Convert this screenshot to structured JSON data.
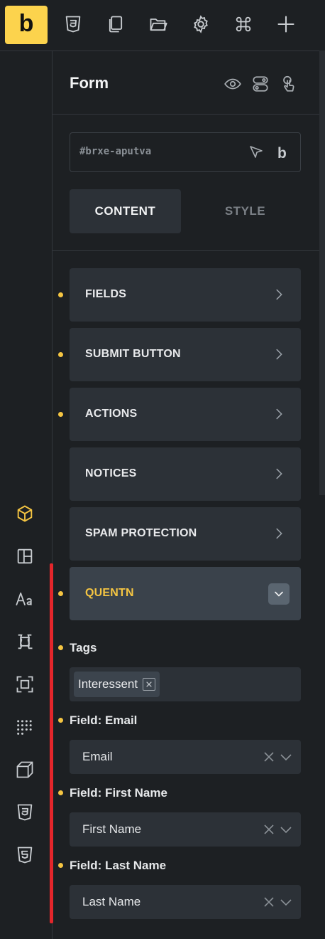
{
  "logo": {
    "letter": "b"
  },
  "topbar": {
    "icons": [
      "css3-icon",
      "pages-icon",
      "folder-icon",
      "settings-gear-icon",
      "command-icon",
      "plus-icon"
    ]
  },
  "left_rail": {
    "icons": [
      "elements-cube-icon",
      "layout-icon",
      "typography-icon",
      "components-icon",
      "frame-icon",
      "grid-dots-icon",
      "box-3d-icon",
      "css3-icon",
      "html5-icon"
    ]
  },
  "panel": {
    "title": "Form",
    "element_id": "#brxe-aputva",
    "tabs": {
      "content": "CONTENT",
      "style": "STYLE"
    },
    "sections": [
      {
        "label": "FIELDS",
        "has_dot": true
      },
      {
        "label": "SUBMIT BUTTON",
        "has_dot": true
      },
      {
        "label": "ACTIONS",
        "has_dot": true
      },
      {
        "label": "NOTICES",
        "has_dot": false
      },
      {
        "label": "SPAM PROTECTION",
        "has_dot": false
      },
      {
        "label": "QUENTN",
        "has_dot": true,
        "open": true
      }
    ],
    "quentn": {
      "tags_label": "Tags",
      "tags": [
        "Interessent"
      ],
      "fields": [
        {
          "label": "Field: Email",
          "value": "Email"
        },
        {
          "label": "Field: First Name",
          "value": "First Name"
        },
        {
          "label": "Field: Last Name",
          "value": "Last Name"
        }
      ]
    }
  },
  "colors": {
    "background": "#1d2023",
    "surface": "#2c3137",
    "accent": "#fcd34d",
    "active_section": "#f5c542",
    "highlight_line": "#e3262b"
  }
}
